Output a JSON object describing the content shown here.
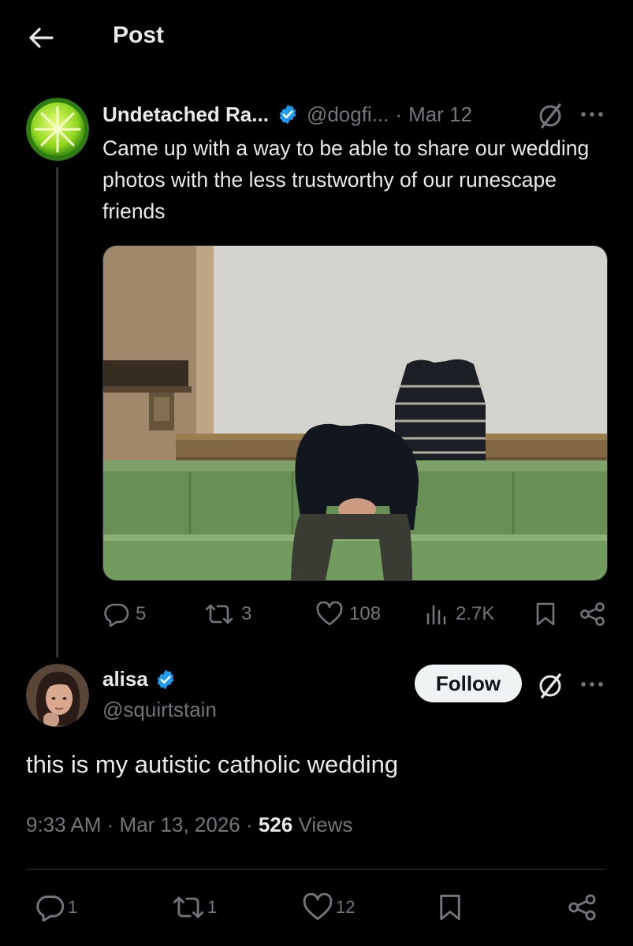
{
  "header": {
    "title": "Post"
  },
  "parent_tweet": {
    "author_name": "Undetached Ra...",
    "handle": "@dogfi...",
    "separator": "·",
    "date": "Mar 12",
    "text": "Came up with a way to be able to share our wedding photos with the less trustworthy of our runescape friends",
    "stats": {
      "replies": "5",
      "reposts": "3",
      "likes": "108",
      "views": "2.7K"
    }
  },
  "reply_tweet": {
    "author_name": "alisa",
    "handle": "@squirtstain",
    "follow_label": "Follow",
    "text": "this is my autistic catholic wedding",
    "time": "9:33 AM",
    "separator": "·",
    "date": "Mar 13, 2026",
    "views_count": "526",
    "views_label": "Views",
    "stats": {
      "replies": "1",
      "reposts": "1",
      "likes": "12"
    }
  },
  "icons": {
    "back": "arrow-left-icon",
    "verified": "verified-badge-icon",
    "grok": "grok-icon",
    "more": "more-dots-icon",
    "reply": "reply-bubble-icon",
    "repost": "repost-icon",
    "like": "heart-icon",
    "views": "views-bars-icon",
    "bookmark": "bookmark-icon",
    "share": "share-icon"
  },
  "colors": {
    "background": "#000000",
    "text": "#e7e9ea",
    "muted": "#71767b",
    "verified": "#1d9bf0",
    "follow_bg": "#eff3f4"
  }
}
